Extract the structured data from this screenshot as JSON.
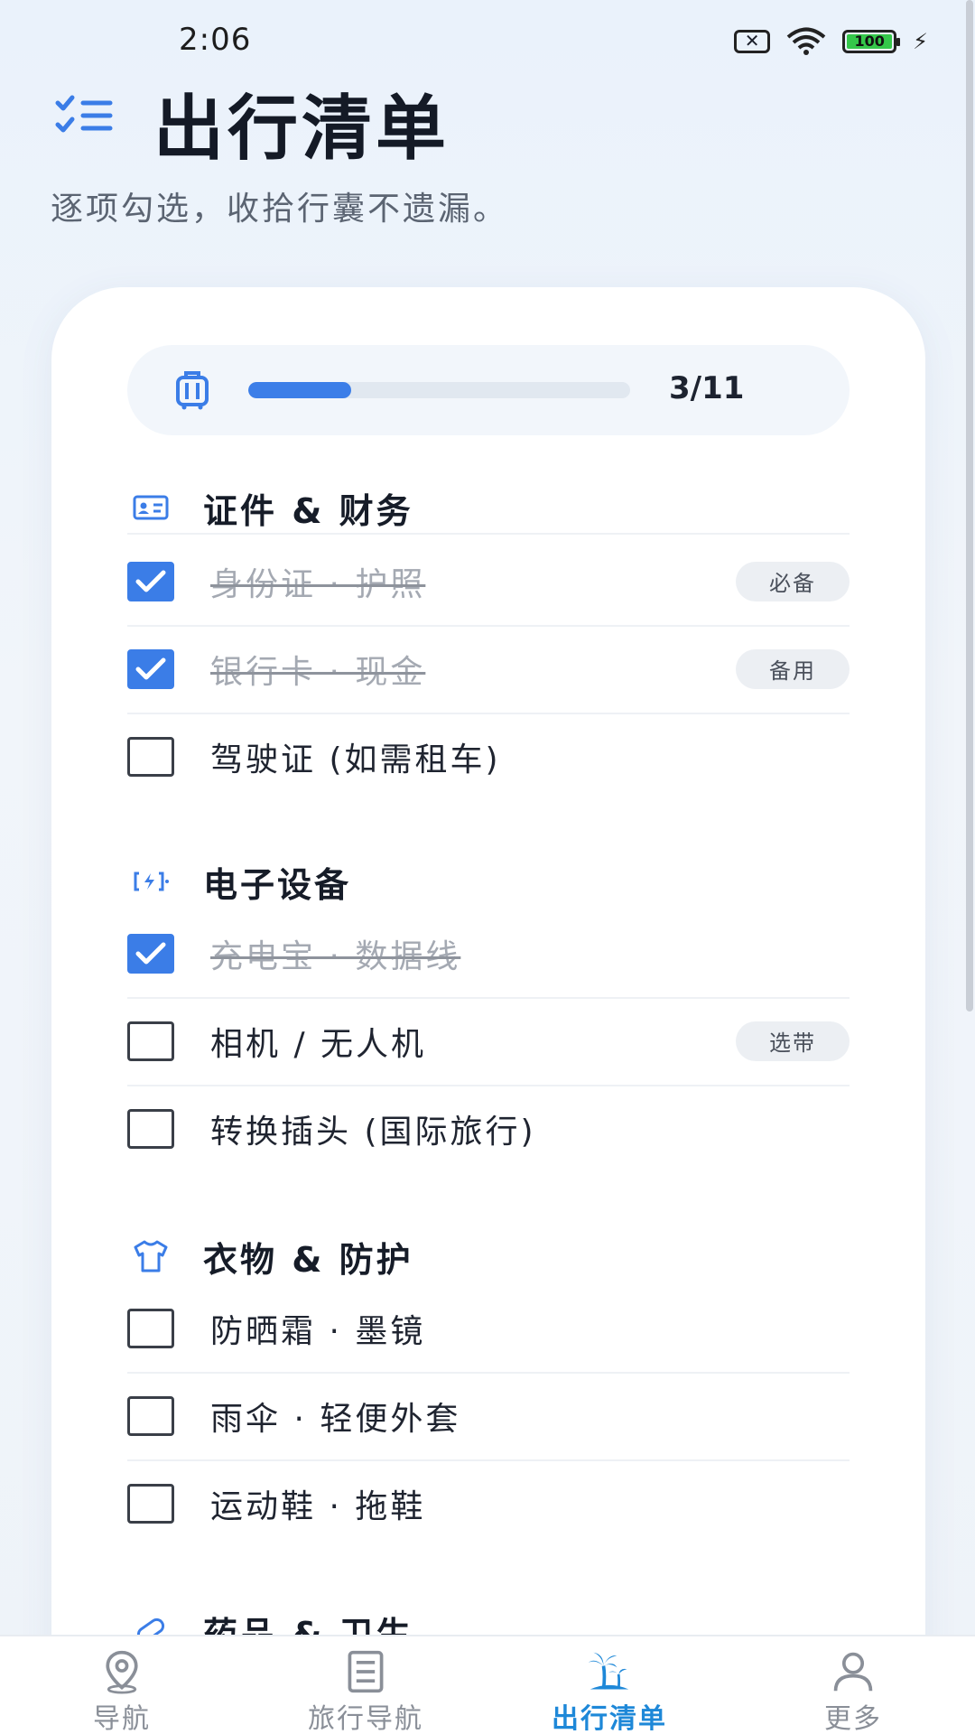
{
  "status_bar": {
    "time": "2:06",
    "battery_level": "100"
  },
  "header": {
    "title": "出行清单",
    "subtitle": "逐项勾选，收拾行囊不遗漏。"
  },
  "progress": {
    "count_text": "3/11",
    "fraction": 0.27
  },
  "sections": [
    {
      "title": "证件 & 财务",
      "icon": "id-card-icon",
      "items": [
        {
          "label": "身份证 · 护照",
          "checked": true,
          "tag": "必备"
        },
        {
          "label": "银行卡 · 现金",
          "checked": true,
          "tag": "备用"
        },
        {
          "label": "驾驶证 (如需租车)",
          "checked": false,
          "tag": ""
        }
      ]
    },
    {
      "title": "电子设备",
      "icon": "charging-icon",
      "items": [
        {
          "label": "充电宝 · 数据线",
          "checked": true,
          "tag": ""
        },
        {
          "label": "相机 / 无人机",
          "checked": false,
          "tag": "选带"
        },
        {
          "label": "转换插头 (国际旅行)",
          "checked": false,
          "tag": ""
        }
      ]
    },
    {
      "title": "衣物 & 防护",
      "icon": "shirt-icon",
      "items": [
        {
          "label": "防晒霜 · 墨镜",
          "checked": false,
          "tag": ""
        },
        {
          "label": "雨伞 · 轻便外套",
          "checked": false,
          "tag": ""
        },
        {
          "label": "运动鞋 · 拖鞋",
          "checked": false,
          "tag": ""
        }
      ]
    },
    {
      "title": "药品 & 卫生",
      "icon": "pill-icon",
      "items": []
    }
  ],
  "bottom_nav": [
    {
      "label": "导航",
      "icon": "location-pin-icon",
      "active": false
    },
    {
      "label": "旅行导航",
      "icon": "document-list-icon",
      "active": false
    },
    {
      "label": "出行清单",
      "icon": "palm-tree-icon",
      "active": true
    },
    {
      "label": "更多",
      "icon": "user-icon",
      "active": false
    }
  ],
  "colors": {
    "accent": "#3b7de7",
    "nav_active": "#1e88d8"
  }
}
